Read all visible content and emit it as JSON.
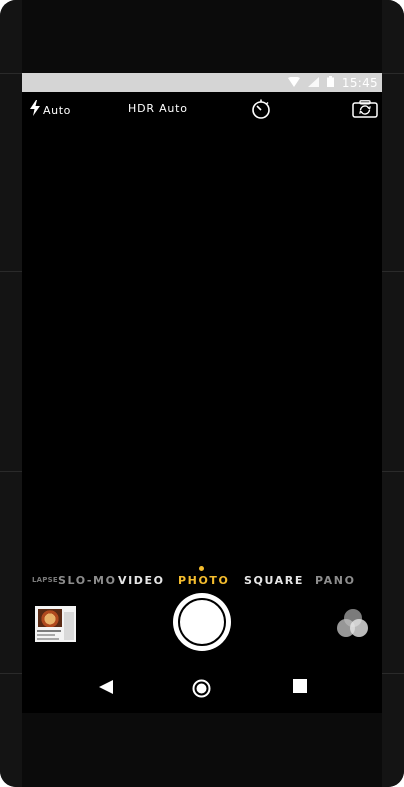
{
  "status_bar": {
    "time": "15:45",
    "icons": [
      "wifi-icon",
      "cell-signal-icon",
      "battery-icon"
    ]
  },
  "top_controls": {
    "flash_label": "Auto",
    "hdr_label": "HDR Auto",
    "icons": [
      "flash-icon",
      "timer-icon",
      "flip-camera-icon"
    ]
  },
  "modes": {
    "items": [
      "LAPSE",
      "SLO-MO",
      "VIDEO",
      "PHOTO",
      "SQUARE",
      "PANO"
    ],
    "selected": "PHOTO"
  },
  "colors": {
    "accent": "#f5bd2e",
    "background": "#000000",
    "status_bar": "#d5d5d5"
  },
  "bottom_controls": {
    "icons": [
      "gallery-thumbnail",
      "shutter-button",
      "filters-icon"
    ]
  },
  "nav_bar": {
    "icons": [
      "back-icon",
      "home-icon",
      "recents-icon"
    ]
  }
}
